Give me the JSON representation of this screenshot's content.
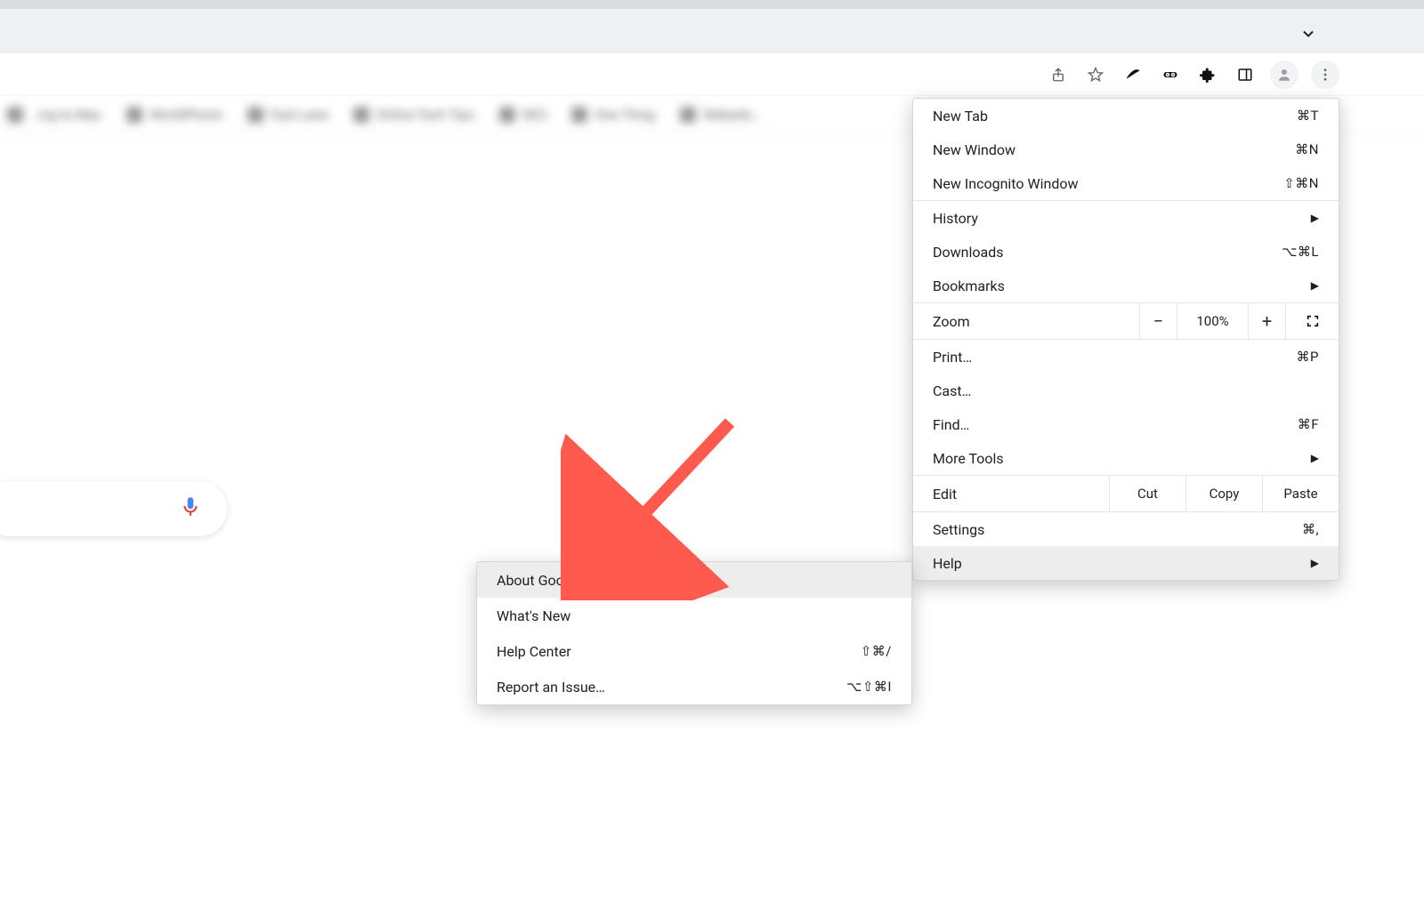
{
  "toolbar": {
    "icons": [
      "share-icon",
      "star-icon",
      "ext-swoosh-icon",
      "ext-eyes-icon",
      "extensions-puzzle-icon",
      "sidepanel-icon",
      "profile-icon",
      "more-menu-icon"
    ]
  },
  "bookmarks": {
    "items": [
      {
        "label": "…ing to Mac"
      },
      {
        "label": "WorldPhone"
      },
      {
        "label": "Fast Lane"
      },
      {
        "label": "Online Tech Tips"
      },
      {
        "label": "SEO"
      },
      {
        "label": "One Thing"
      },
      {
        "label": "Website…"
      }
    ]
  },
  "menu": {
    "new_tab": {
      "label": "New Tab",
      "shortcut": "⌘T"
    },
    "new_window": {
      "label": "New Window",
      "shortcut": "⌘N"
    },
    "new_incognito": {
      "label": "New Incognito Window",
      "shortcut": "⇧⌘N"
    },
    "history": {
      "label": "History"
    },
    "downloads": {
      "label": "Downloads",
      "shortcut": "⌥⌘L"
    },
    "bookmarks": {
      "label": "Bookmarks"
    },
    "zoom": {
      "label": "Zoom",
      "value": "100%"
    },
    "print": {
      "label": "Print…",
      "shortcut": "⌘P"
    },
    "cast": {
      "label": "Cast…"
    },
    "find": {
      "label": "Find…",
      "shortcut": "⌘F"
    },
    "more_tools": {
      "label": "More Tools"
    },
    "edit": {
      "label": "Edit",
      "cut": "Cut",
      "copy": "Copy",
      "paste": "Paste"
    },
    "settings": {
      "label": "Settings",
      "shortcut": "⌘,"
    },
    "help": {
      "label": "Help"
    }
  },
  "help_menu": {
    "about": {
      "label": "About Google Chrome"
    },
    "whats_new": {
      "label": "What's New"
    },
    "help_center": {
      "label": "Help Center",
      "shortcut": "⇧⌘/"
    },
    "report": {
      "label": "Report an Issue…",
      "shortcut": "⌥⇧⌘I"
    }
  }
}
